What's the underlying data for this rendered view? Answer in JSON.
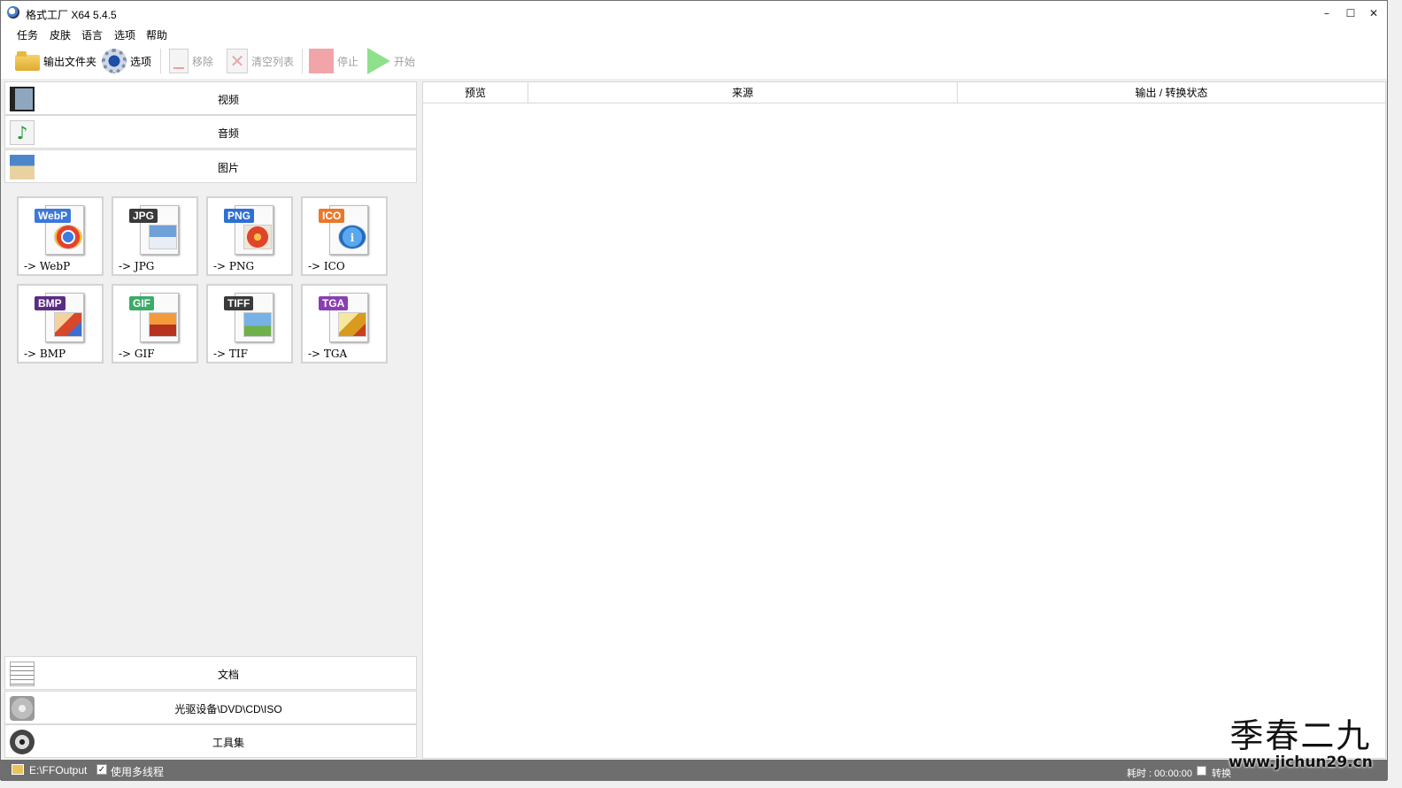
{
  "window": {
    "title": "格式工厂 X64 5.4.5",
    "minimize": "–",
    "maximize": "☐",
    "close": "✕"
  },
  "menu": [
    "任务",
    "皮肤",
    "语言",
    "选项",
    "帮助"
  ],
  "toolbar": {
    "output_folder": "输出文件夹",
    "options": "选项",
    "remove": "移除",
    "clear_list": "清空列表",
    "stop": "停止",
    "start": "开始"
  },
  "categories": {
    "video": "视频",
    "audio": "音频",
    "image": "图片",
    "document": "文档",
    "disc": "光驱设备\\DVD\\CD\\ISO",
    "tools": "工具集"
  },
  "formats": [
    {
      "badge": "WebP",
      "label": "-> WebP",
      "color": "#3b78d8"
    },
    {
      "badge": "JPG",
      "label": "-> JPG",
      "color": "#3a3a3a"
    },
    {
      "badge": "PNG",
      "label": "-> PNG",
      "color": "#2f6fd1"
    },
    {
      "badge": "ICO",
      "label": "-> ICO",
      "color": "#e8782c"
    },
    {
      "badge": "BMP",
      "label": "-> BMP",
      "color": "#5b2c83"
    },
    {
      "badge": "GIF",
      "label": "-> GIF",
      "color": "#3aab69"
    },
    {
      "badge": "TIFF",
      "label": "-> TIF",
      "color": "#3a3a3a"
    },
    {
      "badge": "TGA",
      "label": "-> TGA",
      "color": "#8a3fb1"
    }
  ],
  "table": {
    "columns": [
      "预览",
      "来源",
      "输出 / 转换状态"
    ]
  },
  "status": {
    "path": "E:\\FFOutput",
    "multithread_label": "使用多线程",
    "multithread_checked": "✓",
    "elapsed": "耗时 : 00:00:00",
    "trailing": "转换"
  },
  "watermark": {
    "cn": "季春二九",
    "url": "www.jichun29.cn"
  }
}
